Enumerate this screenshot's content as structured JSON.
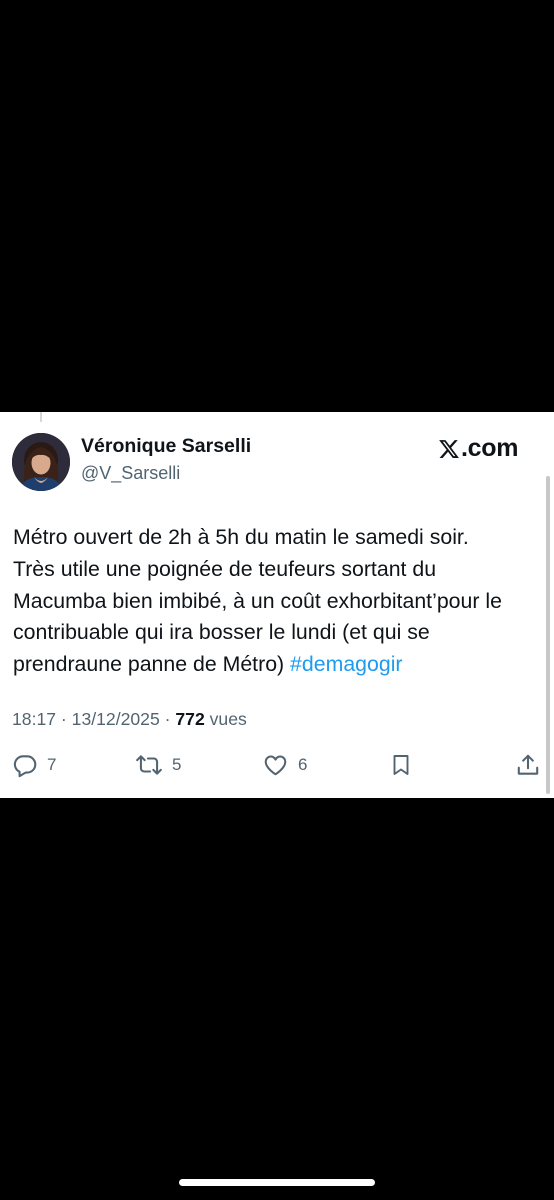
{
  "tweet": {
    "author_name": "Véronique Sarselli",
    "author_handle": "@V_Sarselli",
    "brand": ".com",
    "text_lines": [
      "Métro ouvert de 2h à 5h du matin le samedi soir.",
      "Très utile une poignée de teufeurs sortant du",
      "Macumba bien imbibé, à un coût exhorbitant’pour le",
      "contribuable qui ira bosser le lundi (et qui se",
      "prendraune panne de Métro) "
    ],
    "hashtag": "#demagogir",
    "time": "18:17",
    "separator": " · ",
    "date": "13/12/2025",
    "views_count": "772",
    "views_label": " vues",
    "replies": "7",
    "reposts": "5",
    "likes": "6"
  },
  "colors": {
    "text": "#0f1419",
    "secondary": "#536471",
    "link": "#1d9bf0",
    "background": "#000000",
    "card": "#ffffff"
  },
  "icons": [
    "x-logo-icon",
    "reply-icon",
    "repost-icon",
    "like-icon",
    "bookmark-icon",
    "share-icon"
  ]
}
